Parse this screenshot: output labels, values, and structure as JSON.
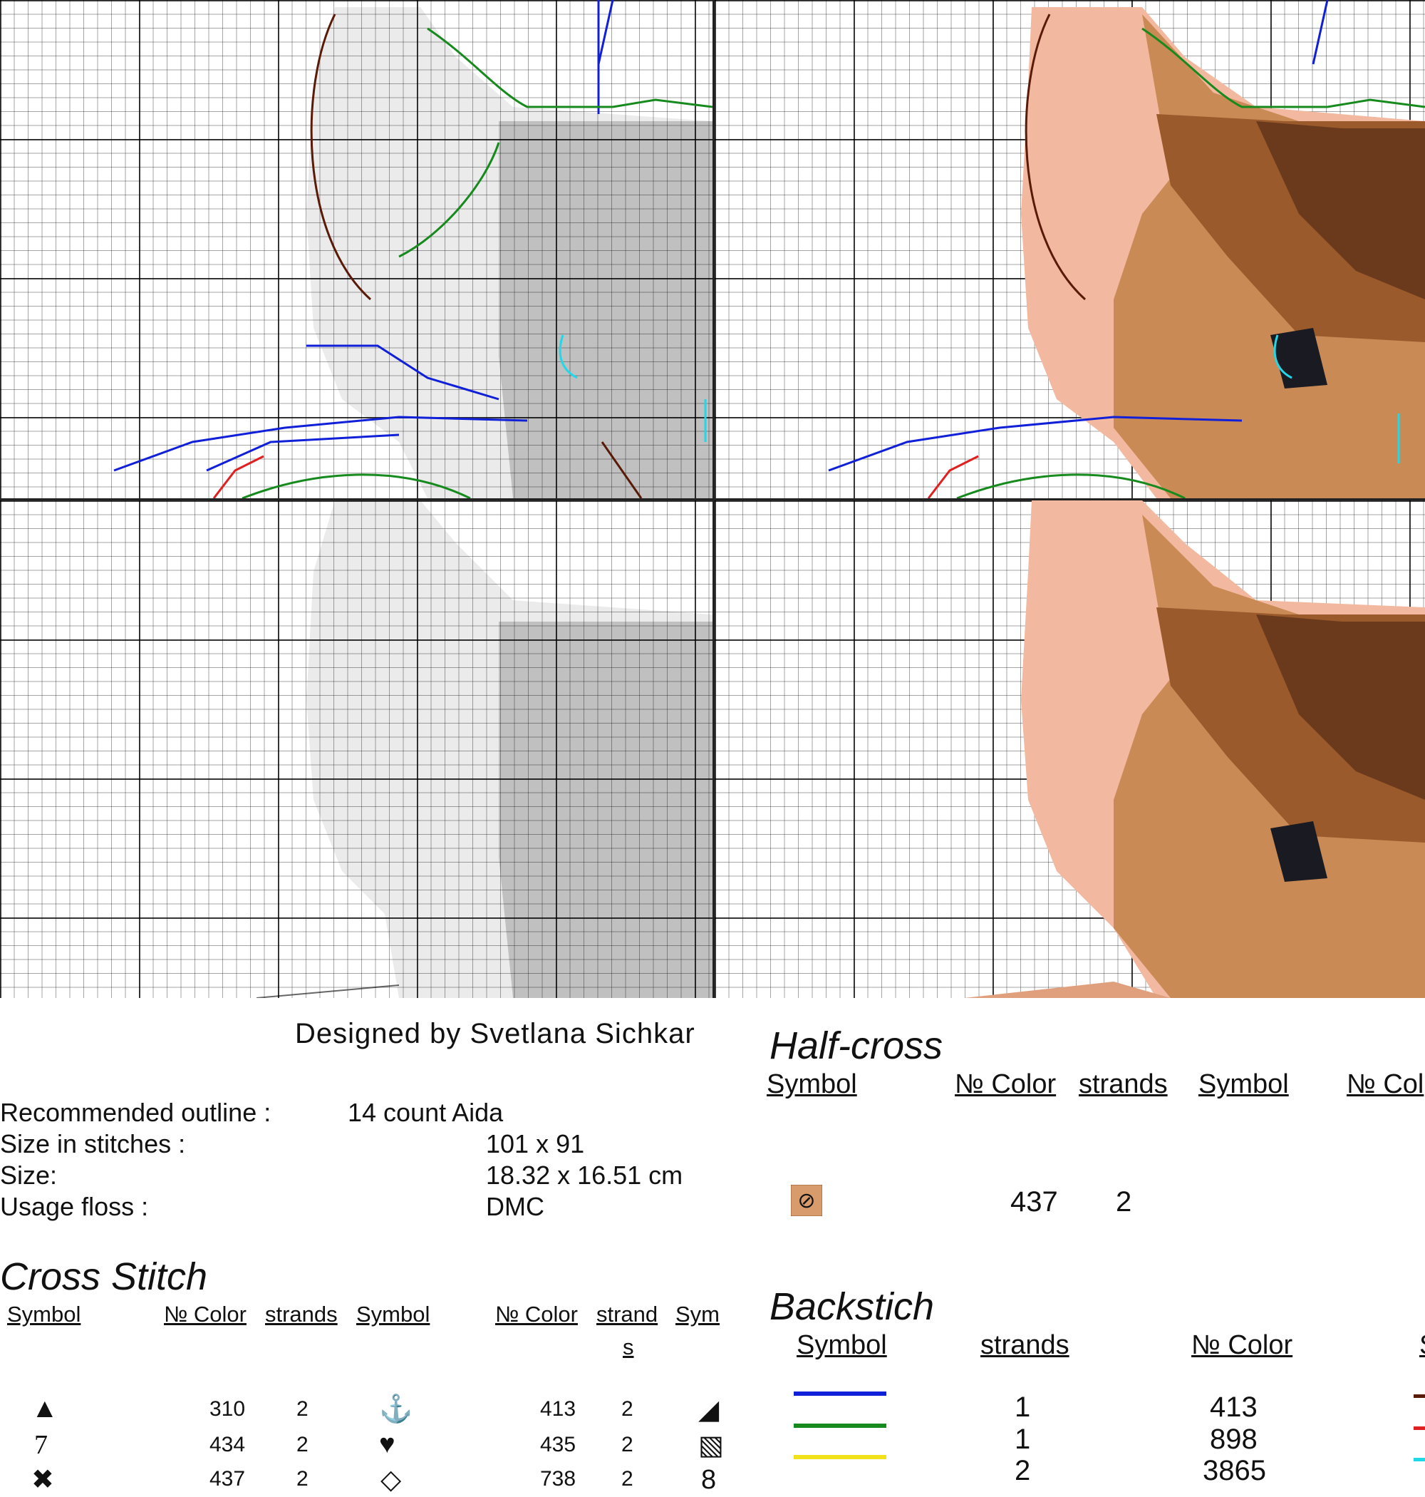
{
  "credit": "Designed by Svetlana Sichkar",
  "info": {
    "rows": [
      {
        "label": "Recommended outline :",
        "value": "14 count Aida"
      },
      {
        "label": "Size in stitches :",
        "value": "101 x 91"
      },
      {
        "label": "Size:",
        "value": "18.32 x 16.51 cm"
      },
      {
        "label": "Usage floss :",
        "value": "DMC"
      }
    ]
  },
  "cross_stitch": {
    "title": "Cross Stitch",
    "headers": {
      "symbol": "Symbol",
      "color": "№ Color",
      "strands": "strands",
      "symbol2": "Symbol",
      "color2": "№ Color",
      "strands2_a": "strand",
      "strands2_b": "s",
      "symbol3": "Sym"
    },
    "rows": [
      {
        "symbol": "▲",
        "color": "310",
        "strands": "2",
        "symbol2": "⚓",
        "color2": "413",
        "strands2": "2",
        "symbol3": "◢"
      },
      {
        "symbol": "7",
        "color": "434",
        "strands": "2",
        "symbol2": "♥",
        "color2": "435",
        "strands2": "2",
        "symbol3": "▧"
      },
      {
        "symbol": "✖",
        "color": "437",
        "strands": "2",
        "symbol2": "◇",
        "color2": "738",
        "strands2": "2",
        "symbol3": "8"
      }
    ]
  },
  "half_cross": {
    "title": "Half-cross",
    "headers": {
      "symbol": "Symbol",
      "color": "№ Color",
      "strands": "strands",
      "symbol2": "Symbol",
      "color2": "№ Col"
    },
    "rows": [
      {
        "symbol": "⊘",
        "color": "437",
        "strands": "2",
        "swatch_color": "#d89b6c"
      }
    ]
  },
  "backstitch": {
    "title": "Backstich",
    "headers": {
      "symbol": "Symbol",
      "strands": "strands",
      "color": "№ Color",
      "symbol2": "S"
    },
    "rows": [
      {
        "line_color": "#1020d8",
        "strands": "1",
        "color": "413"
      },
      {
        "line_color": "#178a1e",
        "strands": "1",
        "color": "898"
      },
      {
        "line_color": "#f2e21c",
        "strands": "2",
        "color": "3865"
      }
    ],
    "stub_colors": [
      "#5a1a08",
      "#e02020",
      "#20d8e8"
    ]
  },
  "palette": {
    "skin_light": "#f2b9a0",
    "skin_mid": "#e0a07e",
    "brown_light": "#c98a55",
    "brown_mid": "#9a5a2c",
    "brown_dark": "#6b3a1c",
    "eye_dark": "#1a1a22",
    "line_blue": "#1020d8",
    "line_green": "#178a1e",
    "line_red": "#e02020",
    "line_cyan": "#20d8e8",
    "line_brown": "#5a1a08"
  }
}
